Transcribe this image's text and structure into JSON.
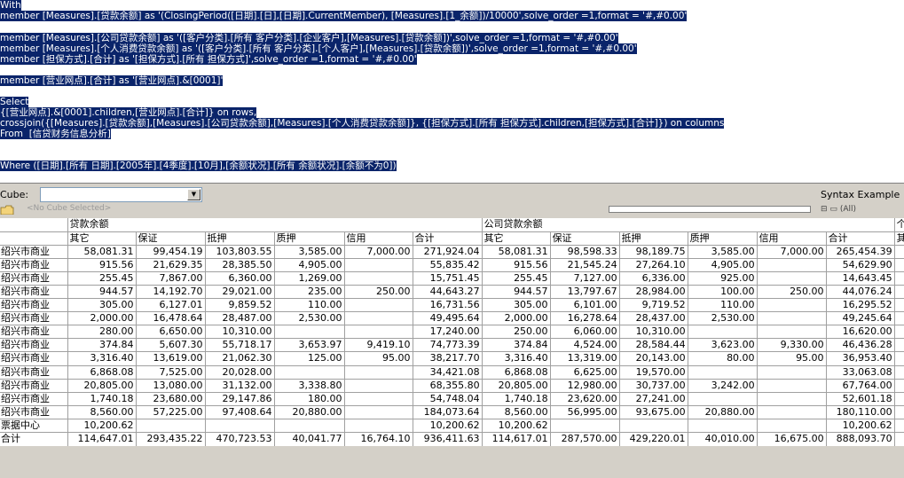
{
  "editor": {
    "lines": [
      {
        "text": "With"
      },
      {
        "text": "member [Measures].[贷款余额] as '(ClosingPeriod([日期].[日],[日期].CurrentMember), [Measures].[1_余额])/10000',solve_order =1,format = '#,#0.00'"
      },
      {
        "text": ""
      },
      {
        "text": "member [Measures].[公司贷款余额] as '([客户分类].[所有 客户分类].[企业客户],[Measures].[贷款余额])',solve_order =1,format = '#,#0.00'"
      },
      {
        "text": "member [Measures].[个人消费贷款余额] as '([客户分类].[所有 客户分类].[个人客户],[Measures].[贷款余额])',solve_order =1,format = '#,#0.00'"
      },
      {
        "text": "member [担保方式].[合计] as '[担保方式].[所有 担保方式]',solve_order =1,format = '#,#0.00'"
      },
      {
        "text": ""
      },
      {
        "text": "member [营业网点].[合计] as '[营业网点].&[0001]'"
      },
      {
        "text": ""
      },
      {
        "text": "Select"
      },
      {
        "text": "{[营业网点].&[0001].children,[营业网点].[合计]} on rows,"
      },
      {
        "text": "crossjoin({[Measures].[贷款余额],[Measures].[公司贷款余额],[Measures].[个人消费贷款余额]}, {[担保方式].[所有 担保方式].children,[担保方式].[合计]}) on columns"
      },
      {
        "text": "From  [信贷财务信息分析]"
      },
      {
        "text": ""
      },
      {
        "text": ""
      },
      {
        "text": "Where ([日期].[所有 日期].[2005年].[4季度].[10月],[余额状况].[所有 余额状况].[余额不为0])"
      }
    ]
  },
  "cubebar": {
    "cube_label": "Cube:",
    "cube_value": "",
    "syntax_label": "Syntax Example",
    "no_cube_text": "<No Cube Selected>",
    "tree_text": "(All)"
  },
  "grid": {
    "groups": [
      {
        "label": "贷款余额",
        "span": 6
      },
      {
        "label": "公司贷款余额",
        "span": 6
      },
      {
        "label": "个",
        "span": 1
      }
    ],
    "subheaders": [
      "其它",
      "保证",
      "抵押",
      "质押",
      "信用",
      "合计",
      "其它",
      "保证",
      "抵押",
      "质押",
      "信用",
      "合计",
      "其"
    ],
    "rows": [
      {
        "label": "绍兴市商业",
        "cells": [
          "58,081.31",
          "99,454.19",
          "103,803.55",
          "3,585.00",
          "7,000.00",
          "271,924.04",
          "58,081.31",
          "98,598.33",
          "98,189.75",
          "3,585.00",
          "7,000.00",
          "265,454.39",
          ""
        ]
      },
      {
        "label": "绍兴市商业",
        "cells": [
          "915.56",
          "21,629.35",
          "28,385.50",
          "4,905.00",
          "",
          "55,835.42",
          "915.56",
          "21,545.24",
          "27,264.10",
          "4,905.00",
          "",
          "54,629.90",
          ""
        ]
      },
      {
        "label": "绍兴市商业",
        "cells": [
          "255.45",
          "7,867.00",
          "6,360.00",
          "1,269.00",
          "",
          "15,751.45",
          "255.45",
          "7,127.00",
          "6,336.00",
          "925.00",
          "",
          "14,643.45",
          ""
        ]
      },
      {
        "label": "绍兴市商业",
        "cells": [
          "944.57",
          "14,192.70",
          "29,021.00",
          "235.00",
          "250.00",
          "44,643.27",
          "944.57",
          "13,797.67",
          "28,984.00",
          "100.00",
          "250.00",
          "44,076.24",
          ""
        ]
      },
      {
        "label": "绍兴市商业",
        "cells": [
          "305.00",
          "6,127.01",
          "9,859.52",
          "110.00",
          "",
          "16,731.56",
          "305.00",
          "6,101.00",
          "9,719.52",
          "110.00",
          "",
          "16,295.52",
          ""
        ]
      },
      {
        "label": "绍兴市商业",
        "cells": [
          "2,000.00",
          "16,478.64",
          "28,487.00",
          "2,530.00",
          "",
          "49,495.64",
          "2,000.00",
          "16,278.64",
          "28,437.00",
          "2,530.00",
          "",
          "49,245.64",
          ""
        ]
      },
      {
        "label": "绍兴市商业",
        "cells": [
          "280.00",
          "6,650.00",
          "10,310.00",
          "",
          "",
          "17,240.00",
          "250.00",
          "6,060.00",
          "10,310.00",
          "",
          "",
          "16,620.00",
          ""
        ]
      },
      {
        "label": "绍兴市商业",
        "cells": [
          "374.84",
          "5,607.30",
          "55,718.17",
          "3,653.97",
          "9,419.10",
          "74,773.39",
          "374.84",
          "4,524.00",
          "28,584.44",
          "3,623.00",
          "9,330.00",
          "46,436.28",
          ""
        ]
      },
      {
        "label": "绍兴市商业",
        "cells": [
          "3,316.40",
          "13,619.00",
          "21,062.30",
          "125.00",
          "95.00",
          "38,217.70",
          "3,316.40",
          "13,319.00",
          "20,143.00",
          "80.00",
          "95.00",
          "36,953.40",
          ""
        ]
      },
      {
        "label": "绍兴市商业",
        "cells": [
          "6,868.08",
          "7,525.00",
          "20,028.00",
          "",
          "",
          "34,421.08",
          "6,868.08",
          "6,625.00",
          "19,570.00",
          "",
          "",
          "33,063.08",
          ""
        ]
      },
      {
        "label": "绍兴市商业",
        "cells": [
          "20,805.00",
          "13,080.00",
          "31,132.00",
          "3,338.80",
          "",
          "68,355.80",
          "20,805.00",
          "12,980.00",
          "30,737.00",
          "3,242.00",
          "",
          "67,764.00",
          ""
        ]
      },
      {
        "label": "绍兴市商业",
        "cells": [
          "1,740.18",
          "23,680.00",
          "29,147.86",
          "180.00",
          "",
          "54,748.04",
          "1,740.18",
          "23,620.00",
          "27,241.00",
          "",
          "",
          "52,601.18",
          ""
        ]
      },
      {
        "label": "绍兴市商业",
        "cells": [
          "8,560.00",
          "57,225.00",
          "97,408.64",
          "20,880.00",
          "",
          "184,073.64",
          "8,560.00",
          "56,995.00",
          "93,675.00",
          "20,880.00",
          "",
          "180,110.00",
          ""
        ]
      },
      {
        "label": "票据中心",
        "cells": [
          "10,200.62",
          "",
          "",
          "",
          "",
          "10,200.62",
          "10,200.62",
          "",
          "",
          "",
          "",
          "10,200.62",
          ""
        ]
      },
      {
        "label": "合计",
        "cells": [
          "114,647.01",
          "293,435.22",
          "470,723.53",
          "40,041.77",
          "16,764.10",
          "936,411.63",
          "114,617.01",
          "287,570.00",
          "429,220.01",
          "40,010.00",
          "16,675.00",
          "888,093.70",
          ""
        ]
      }
    ]
  }
}
